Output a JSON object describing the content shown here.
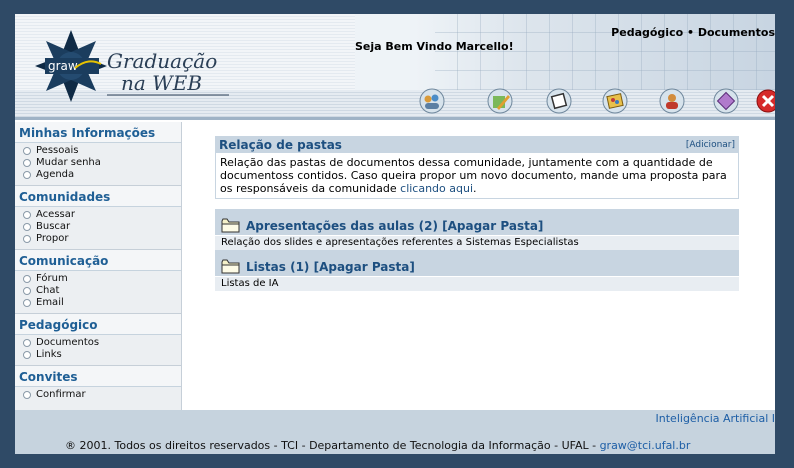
{
  "header": {
    "welcome": "Seja Bem Vindo Marcello!",
    "breadcrumb": "Pedagógico • Documentos",
    "logo_text_1": "Graduação",
    "logo_text_2": "na WEB",
    "logo_badge": "graw"
  },
  "toolbar": {
    "buttons": [
      "people-icon",
      "edit-icon",
      "window-icon",
      "palette-icon",
      "user-icon",
      "diamond-icon",
      "close-icon"
    ]
  },
  "sidebar": {
    "sections": [
      {
        "title": "Minhas Informações",
        "items": [
          "Pessoais",
          "Mudar senha",
          "Agenda"
        ]
      },
      {
        "title": "Comunidades",
        "items": [
          "Acessar",
          "Buscar",
          "Propor"
        ]
      },
      {
        "title": "Comunicação",
        "items": [
          "Fórum",
          "Chat",
          "Email"
        ]
      },
      {
        "title": "Pedagógico",
        "items": [
          "Documentos",
          "Links"
        ]
      },
      {
        "title": "Convites",
        "items": [
          "Confirmar"
        ]
      }
    ]
  },
  "main": {
    "title": "Relação de pastas",
    "add_label": "[Adicionar]",
    "description_prefix": "Relação das pastas de documentos dessa comunidade, juntamente com a quantidade de documentoss contidos. Caso queira propor um novo documento, mande uma proposta para os responsáveis da comunidade ",
    "description_link": "clicando aqui",
    "description_suffix": ".",
    "folders": [
      {
        "name": "Apresentações das aulas",
        "count": "(2)",
        "delete_label": "[Apagar Pasta]",
        "description": "Relação dos slides e apresentações referentes a Sistemas Especialistas"
      },
      {
        "name": "Listas",
        "count": "(1)",
        "delete_label": "[Apagar Pasta]",
        "description": "Listas de IA"
      }
    ]
  },
  "footer": {
    "community": "Inteligência Artificial I",
    "copyright": "® 2001. Todos os direitos reservados - TCI - Departamento de Tecnologia da Informação - UFAL - ",
    "email": "graw@tci.ufal.br"
  }
}
